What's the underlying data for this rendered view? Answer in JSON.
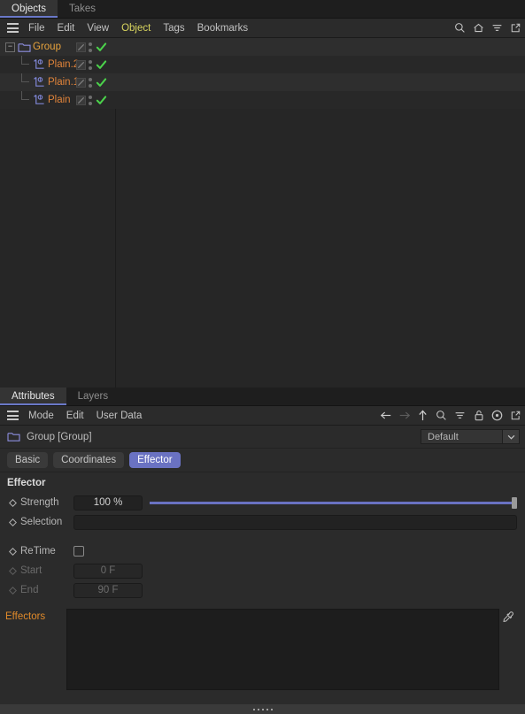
{
  "object_manager": {
    "tabs": [
      {
        "label": "Objects",
        "active": true
      },
      {
        "label": "Takes",
        "active": false
      }
    ],
    "menu": [
      "File",
      "Edit",
      "View",
      "Object",
      "Tags",
      "Bookmarks"
    ],
    "menu_highlight": "Object",
    "toolbar_icons": [
      "search-icon",
      "home-icon",
      "filter-icon",
      "external-link-icon"
    ],
    "rows": [
      {
        "name": "Group",
        "type": "group",
        "depth": 0,
        "expanded": true,
        "icon": "folder-icon",
        "enabled": true
      },
      {
        "name": "Plain.2",
        "type": "object",
        "depth": 1,
        "expanded": false,
        "icon": "effector-icon",
        "enabled": true
      },
      {
        "name": "Plain.1",
        "type": "object",
        "depth": 1,
        "expanded": false,
        "icon": "effector-icon",
        "enabled": true
      },
      {
        "name": "Plain",
        "type": "object",
        "depth": 1,
        "expanded": false,
        "icon": "effector-icon",
        "enabled": true
      }
    ]
  },
  "attributes": {
    "tabs": [
      {
        "label": "Attributes",
        "active": true
      },
      {
        "label": "Layers",
        "active": false
      }
    ],
    "menu": [
      "Mode",
      "Edit",
      "User Data"
    ],
    "toolbar_icons": [
      "back-arrow-icon",
      "forward-arrow-icon",
      "up-arrow-icon",
      "search-icon",
      "filter-icon",
      "lock-icon",
      "record-icon",
      "external-link-icon"
    ],
    "object_title": "Group [Group]",
    "object_icon": "folder-icon",
    "preset": {
      "value": "Default",
      "caret": "chevron-down-icon"
    },
    "param_tabs": [
      {
        "label": "Basic",
        "active": false
      },
      {
        "label": "Coordinates",
        "active": false
      },
      {
        "label": "Effector",
        "active": true
      }
    ],
    "section": {
      "title": "Effector",
      "params": [
        {
          "label": "Strength",
          "value": "100 %",
          "kind": "slider",
          "slider_percent": 100,
          "enabled": true
        },
        {
          "label": "Selection",
          "value": "",
          "kind": "text",
          "enabled": true
        },
        {
          "label": "ReTime",
          "value": "",
          "kind": "checkbox",
          "checked": false,
          "enabled": true
        },
        {
          "label": "Start",
          "value": "0 F",
          "kind": "number",
          "enabled": false
        },
        {
          "label": "End",
          "value": "90 F",
          "kind": "number",
          "enabled": false
        }
      ],
      "effectors_label": "Effectors",
      "effectors_items": [],
      "eyedropper_icon": "eyedropper-icon"
    }
  },
  "colors": {
    "accent": "#6a72c2",
    "group_text": "#e8a33d",
    "object_text": "#e0833a",
    "effectors_label": "#e08a2a",
    "check_green": "#4bd24b",
    "menu_highlight": "#d8d45e",
    "panel_bg": "#2b2b2b",
    "tree_bg": "#262626"
  }
}
